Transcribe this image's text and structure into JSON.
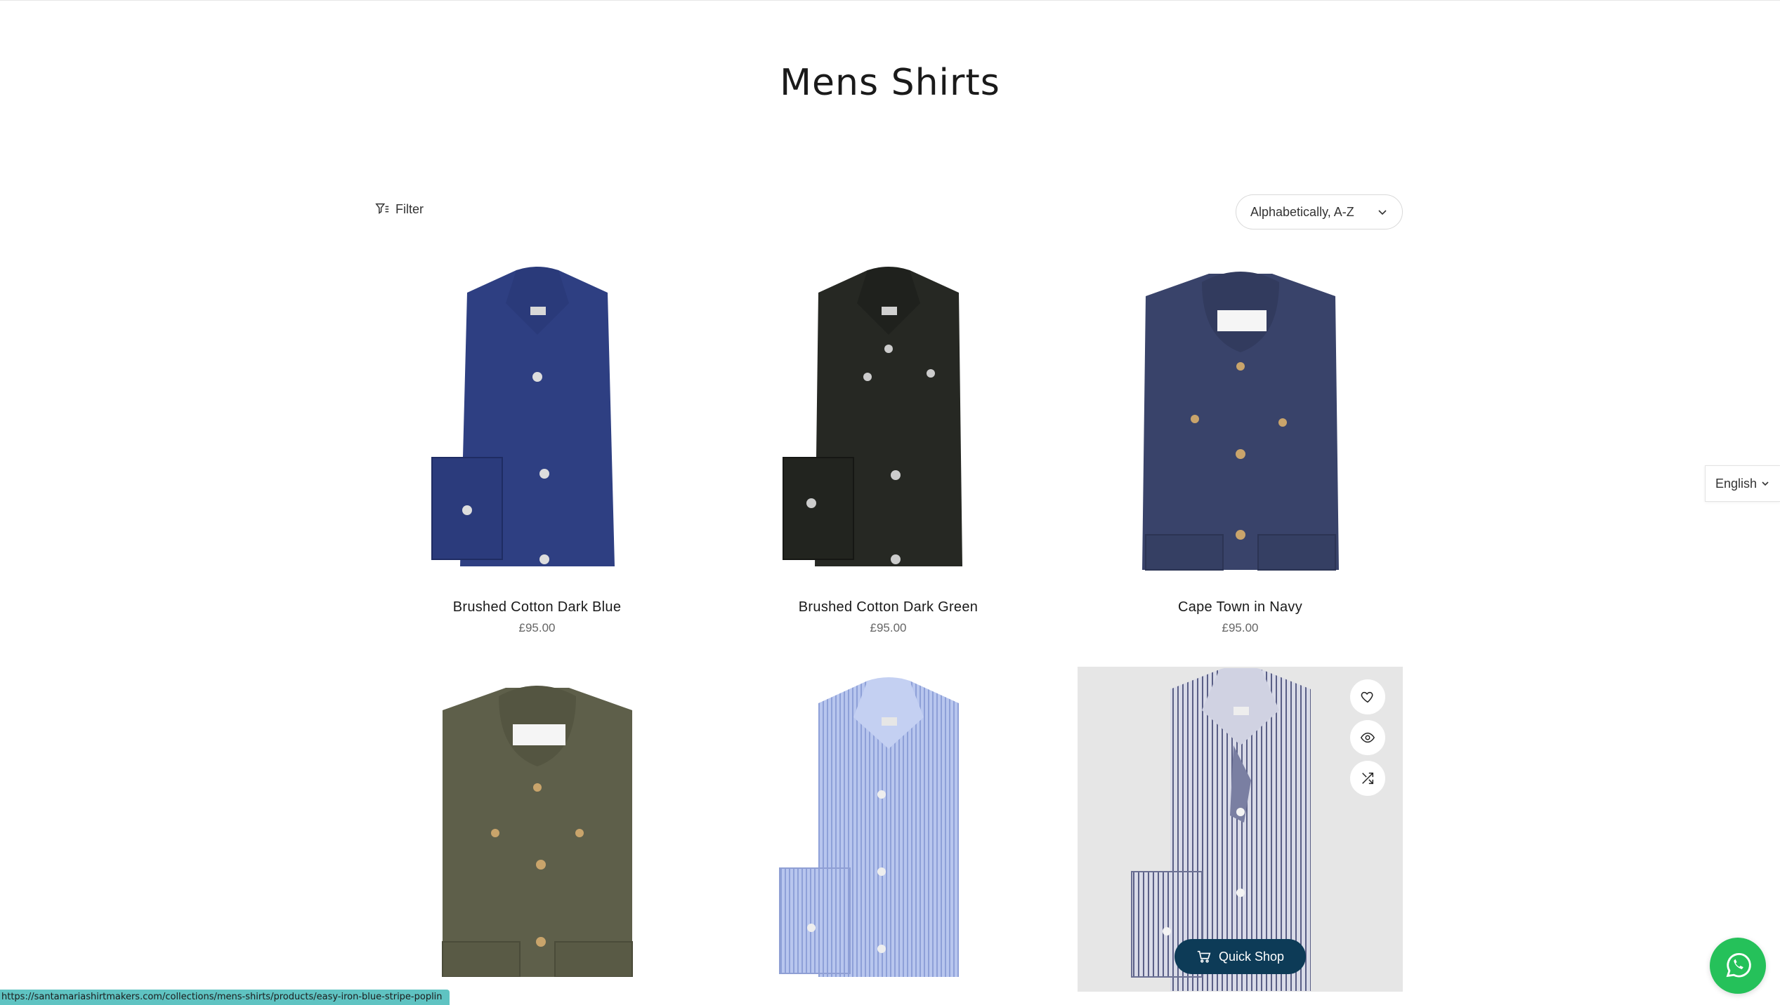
{
  "page": {
    "title": "Mens Shirts"
  },
  "toolbar": {
    "filter_label": "Filter",
    "sort_selected": "Alphabetically, A-Z"
  },
  "products": [
    {
      "name": "Brushed Cotton Dark Blue",
      "price": "£95.00"
    },
    {
      "name": "Brushed Cotton Dark Green",
      "price": "£95.00"
    },
    {
      "name": "Cape Town in Navy",
      "price": "£95.00"
    },
    {
      "name": "",
      "price": ""
    },
    {
      "name": "",
      "price": ""
    },
    {
      "name": "",
      "price": ""
    }
  ],
  "hover_card": {
    "quick_shop_label": "Quick Shop",
    "actions": [
      "heart-icon",
      "eye-icon",
      "compare-icon"
    ]
  },
  "language": {
    "selected": "English"
  },
  "status_bar": {
    "url": "https://santamariashirtmakers.com/collections/mens-shirts/products/easy-iron-blue-stripe-poplin"
  },
  "colors": {
    "quick_shop_bg": "#0d3b57",
    "whatsapp_green": "#25c15a",
    "hover_bg": "#e6e6e6",
    "status_bar_bg": "#5fc3c2"
  }
}
